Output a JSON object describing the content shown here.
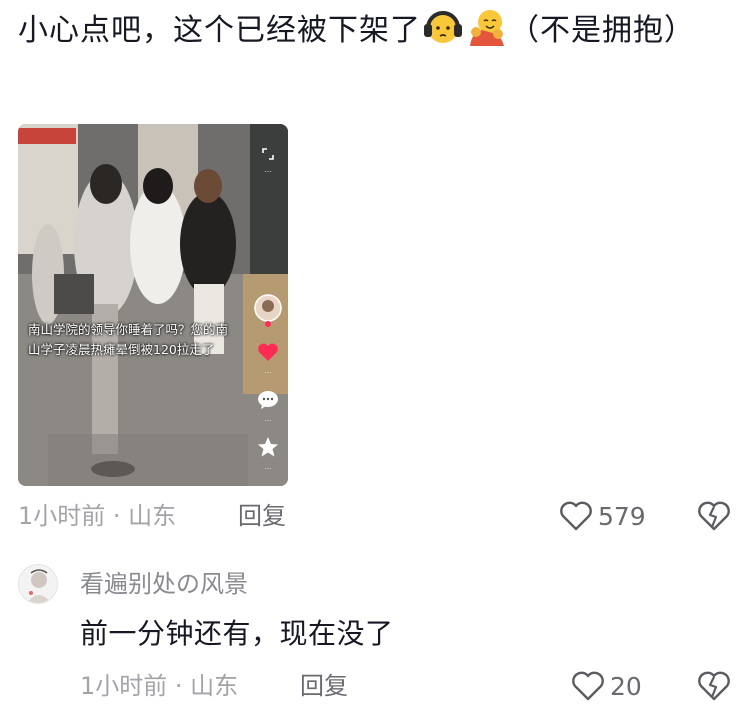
{
  "comment": {
    "text_part1": "小心点吧，这个已经被下架了",
    "text_part2": "（不是拥抱）",
    "emojis": [
      "headphone-face-emoji",
      "hugging-face-emoji"
    ],
    "video": {
      "overlay_caption": "南山学院的领导你睡着了吗？您的南山学子凌晨热瘫晕倒被120拉走了",
      "side_counts": [
        "...",
        "...",
        "...",
        "..."
      ]
    },
    "time": "1小时前 · 山东",
    "reply_label": "回复",
    "like_count": "579"
  },
  "reply": {
    "username": "看遍别处の风景",
    "text": "前一分钟还有，现在没了",
    "time": "1小时前 · 山东",
    "reply_label": "回复",
    "like_count": "20"
  },
  "colors": {
    "text": "#161823",
    "meta": "#a3a4aa",
    "action": "#696a70",
    "username": "#8a8b91"
  }
}
